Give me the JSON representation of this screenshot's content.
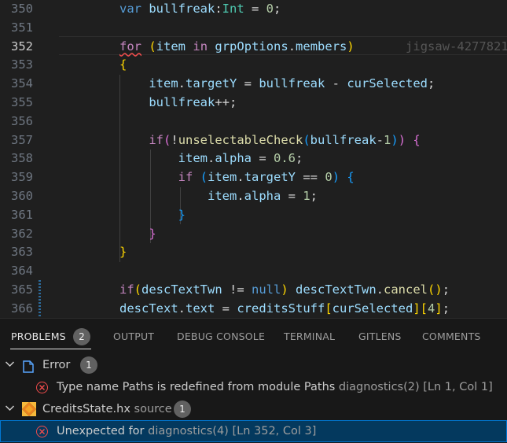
{
  "editor": {
    "lines": [
      {
        "n": "350",
        "tokens": [
          [
            "kw",
            "var "
          ],
          [
            "var",
            "bullfreak"
          ],
          [
            "op",
            ":"
          ],
          [
            "type",
            "Int"
          ],
          [
            "op",
            " = "
          ],
          [
            "num",
            "0"
          ],
          [
            "op",
            ";"
          ]
        ]
      },
      {
        "n": "351",
        "tokens": []
      },
      {
        "n": "352",
        "tokens": [
          [
            "ctl squiggle",
            "for"
          ],
          [
            "op",
            " "
          ],
          [
            "par1",
            "("
          ],
          [
            "var",
            "item"
          ],
          [
            "op",
            " "
          ],
          [
            "ctl",
            "in"
          ],
          [
            "op",
            " "
          ],
          [
            "var",
            "grpOptions"
          ],
          [
            "op",
            "."
          ],
          [
            "var",
            "members"
          ],
          [
            "par1",
            ")"
          ],
          [
            "lens",
            "       jigsaw-4277821"
          ]
        ]
      },
      {
        "n": "353",
        "tokens": [
          [
            "par1",
            "{"
          ]
        ]
      },
      {
        "n": "354",
        "tokens": [
          [
            "op",
            "    "
          ],
          [
            "var",
            "item"
          ],
          [
            "op",
            "."
          ],
          [
            "var",
            "targetY"
          ],
          [
            "op",
            " = "
          ],
          [
            "var",
            "bullfreak"
          ],
          [
            "op",
            " - "
          ],
          [
            "var",
            "curSelected"
          ],
          [
            "op",
            ";"
          ]
        ]
      },
      {
        "n": "355",
        "tokens": [
          [
            "op",
            "    "
          ],
          [
            "var",
            "bullfreak"
          ],
          [
            "op",
            "++;"
          ]
        ]
      },
      {
        "n": "356",
        "tokens": []
      },
      {
        "n": "357",
        "tokens": [
          [
            "op",
            "    "
          ],
          [
            "ctl",
            "if"
          ],
          [
            "par2",
            "("
          ],
          [
            "op",
            "!"
          ],
          [
            "fn",
            "unselectableCheck"
          ],
          [
            "par3",
            "("
          ],
          [
            "var",
            "bullfreak"
          ],
          [
            "op",
            "-"
          ],
          [
            "num",
            "1"
          ],
          [
            "par3",
            ")"
          ],
          [
            "par2",
            ")"
          ],
          [
            "op",
            " "
          ],
          [
            "par2",
            "{"
          ]
        ]
      },
      {
        "n": "358",
        "tokens": [
          [
            "op",
            "        "
          ],
          [
            "var",
            "item"
          ],
          [
            "op",
            "."
          ],
          [
            "var",
            "alpha"
          ],
          [
            "op",
            " = "
          ],
          [
            "num",
            "0.6"
          ],
          [
            "op",
            ";"
          ]
        ]
      },
      {
        "n": "359",
        "tokens": [
          [
            "op",
            "        "
          ],
          [
            "ctl",
            "if"
          ],
          [
            "op",
            " "
          ],
          [
            "par3",
            "("
          ],
          [
            "var",
            "item"
          ],
          [
            "op",
            "."
          ],
          [
            "var",
            "targetY"
          ],
          [
            "op",
            " == "
          ],
          [
            "num",
            "0"
          ],
          [
            "par3",
            ")"
          ],
          [
            "op",
            " "
          ],
          [
            "par3",
            "{"
          ]
        ]
      },
      {
        "n": "360",
        "tokens": [
          [
            "op",
            "            "
          ],
          [
            "var",
            "item"
          ],
          [
            "op",
            "."
          ],
          [
            "var",
            "alpha"
          ],
          [
            "op",
            " = "
          ],
          [
            "num",
            "1"
          ],
          [
            "op",
            ";"
          ]
        ]
      },
      {
        "n": "361",
        "tokens": [
          [
            "op",
            "        "
          ],
          [
            "par3",
            "}"
          ]
        ]
      },
      {
        "n": "362",
        "tokens": [
          [
            "op",
            "    "
          ],
          [
            "par2",
            "}"
          ]
        ]
      },
      {
        "n": "363",
        "tokens": [
          [
            "par1",
            "}"
          ]
        ]
      },
      {
        "n": "364",
        "tokens": []
      },
      {
        "n": "365",
        "tokens": [
          [
            "ctl",
            "if"
          ],
          [
            "par1",
            "("
          ],
          [
            "var",
            "descTextTwn"
          ],
          [
            "op",
            " != "
          ],
          [
            "kw",
            "null"
          ],
          [
            "par1",
            ")"
          ],
          [
            "op",
            " "
          ],
          [
            "var",
            "descTextTwn"
          ],
          [
            "op",
            "."
          ],
          [
            "fn",
            "cancel"
          ],
          [
            "par1",
            "()"
          ],
          [
            "op",
            ";"
          ]
        ]
      },
      {
        "n": "366",
        "tokens": [
          [
            "var",
            "descText"
          ],
          [
            "op",
            "."
          ],
          [
            "var",
            "text"
          ],
          [
            "op",
            " = "
          ],
          [
            "var",
            "creditsStuff"
          ],
          [
            "par1",
            "["
          ],
          [
            "var",
            "curSelected"
          ],
          [
            "par1",
            "]"
          ],
          [
            "par1",
            "["
          ],
          [
            "num",
            "4"
          ],
          [
            "par1",
            "]"
          ],
          [
            "op",
            ";"
          ]
        ]
      }
    ]
  },
  "panel": {
    "tabs": [
      {
        "label": "PROBLEMS",
        "badge": "2"
      },
      {
        "label": "OUTPUT"
      },
      {
        "label": "DEBUG CONSOLE"
      },
      {
        "label": "TERMINAL"
      },
      {
        "label": "GITLENS"
      },
      {
        "label": "COMMENTS"
      }
    ],
    "groups": [
      {
        "name": "Error",
        "count": "1",
        "icon": "file-icon",
        "problem": {
          "message": "Type name Paths is redefined from module Paths",
          "source": "diagnostics(2)",
          "location": "[Ln 1, Col 1]"
        }
      },
      {
        "name": "CreditsState.hx",
        "detail": "source",
        "count": "1",
        "icon": "haxe-icon",
        "problem": {
          "message": "Unexpected for",
          "source": "diagnostics(4)",
          "location": "[Ln 352, Col 3]"
        }
      }
    ]
  },
  "colors": {
    "editor_bg": "#1f1f1f",
    "panel_bg": "#181818",
    "error": "#f14c4c",
    "selection": "#04395e",
    "focus_border": "#0078d4",
    "haxe_orange": "#ea8220"
  }
}
